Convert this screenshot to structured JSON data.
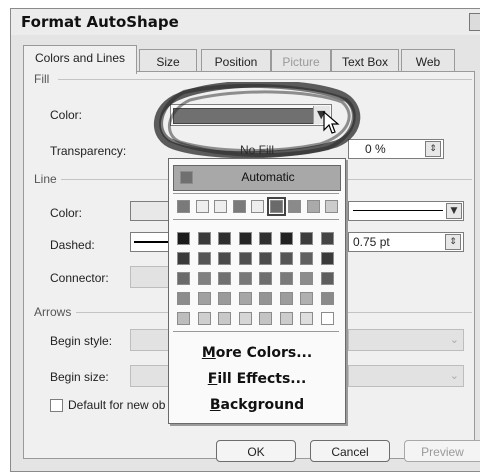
{
  "dialog": {
    "title": "Format AutoShape",
    "tabs": [
      {
        "label": "Colors and Lines",
        "state": "active"
      },
      {
        "label": "Size",
        "state": "normal"
      },
      {
        "label": "Position",
        "state": "normal"
      },
      {
        "label": "Picture",
        "state": "disabled"
      },
      {
        "label": "Text Box",
        "state": "normal"
      },
      {
        "label": "Web",
        "state": "normal"
      }
    ]
  },
  "fill": {
    "section": "Fill",
    "color_label": "Color:",
    "transparency_label": "Transparency:",
    "transparency_value": "0 %"
  },
  "line": {
    "section": "Line",
    "color_label": "Color:",
    "dashed_label": "Dashed:",
    "connector_label": "Connector:",
    "weight_value": "0.75 pt"
  },
  "arrows": {
    "section": "Arrows",
    "begin_style_label": "Begin style:",
    "begin_size_label": "Begin size:",
    "default_checkbox_label": "Default for new ob"
  },
  "buttons": {
    "ok": "OK",
    "cancel": "Cancel",
    "preview": "Preview"
  },
  "color_popup": {
    "no_fill": "No Fill",
    "automatic": "Automatic",
    "recent_colors": [
      "#7a7a7a",
      "#eeeeee",
      "#eeeeee",
      "#7a7a7a",
      "#eeeeee",
      "#6a6a6a",
      "#8a8a8a",
      "#aaaaaa",
      "#cccccc"
    ],
    "palette": [
      [
        "#1a1a1a",
        "#3a3a3a",
        "#2e2e2e",
        "#262626",
        "#303030",
        "#222222",
        "#3c3c3c",
        "#444444"
      ],
      [
        "#3a3a3a",
        "#555555",
        "#4a4a4a",
        "#505050",
        "#4c4c4c",
        "#555555",
        "#606060",
        "#3a3a3a"
      ],
      [
        "#6a6a6a",
        "#808080",
        "#707070",
        "#787878",
        "#6e6e6e",
        "#7a7a7a",
        "#8c8c8c",
        "#5e5e5e"
      ],
      [
        "#8c8c8c",
        "#a0a0a0",
        "#9a9a9a",
        "#a6a6a6",
        "#949494",
        "#9c9c9c",
        "#b0b0b0",
        "#8a8a8a"
      ],
      [
        "#bdbdbd",
        "#cfcfcf",
        "#c8c8c8",
        "#d6d6d6",
        "#c4c4c4",
        "#cccccc",
        "#dedede",
        "#ffffff"
      ]
    ],
    "more_colors_prefix": "",
    "more_colors_u": "M",
    "more_colors_rest": "ore Colors...",
    "fill_effects_u": "F",
    "fill_effects_rest": "ill Effects...",
    "background_u": "B",
    "background_rest": "ackground"
  }
}
